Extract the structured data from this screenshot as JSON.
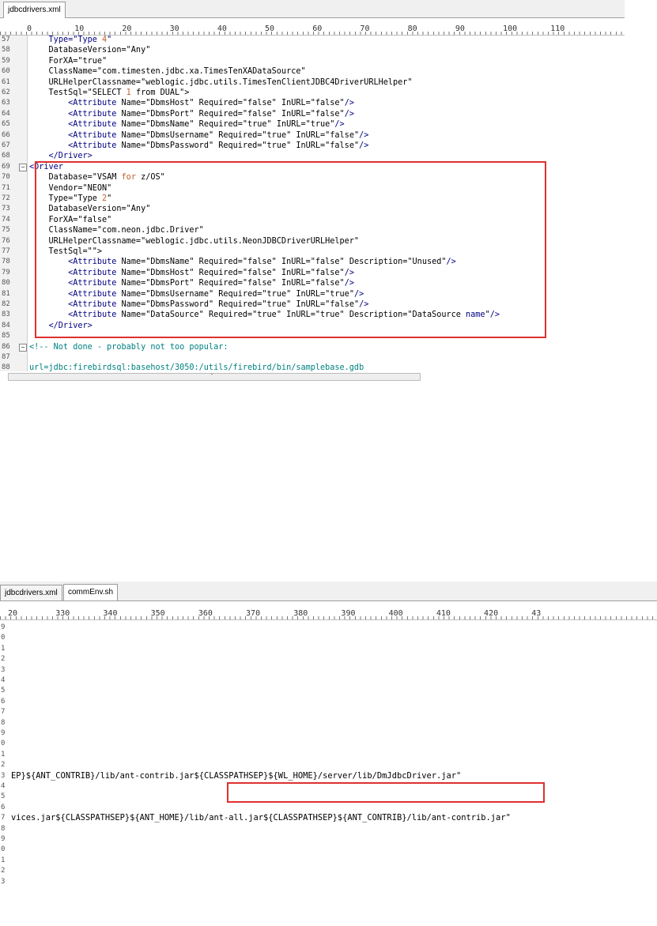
{
  "panel1": {
    "tabs": [
      {
        "label": "jdbcdrivers.xml",
        "active": true
      }
    ],
    "ruler": "0         10        20        30        40        50        60        70        80        90        100       110",
    "lines": [
      {
        "num": "57",
        "segments": [
          {
            "t": "    ",
            "c": "v"
          },
          {
            "t": "Type=",
            "c": "t"
          },
          {
            "t": "\"Type ",
            "c": "s"
          },
          {
            "t": "4",
            "c": "k"
          },
          {
            "t": "\"",
            "c": "s"
          }
        ]
      },
      {
        "num": "58",
        "segments": [
          {
            "t": "    DatabaseVersion=\"Any\"",
            "c": "v"
          }
        ]
      },
      {
        "num": "59",
        "segments": [
          {
            "t": "    ForXA=\"true\"",
            "c": "v"
          }
        ]
      },
      {
        "num": "60",
        "segments": [
          {
            "t": "    ClassName=\"com.timesten.jdbc.xa.TimesTenXADataSource\"",
            "c": "v"
          }
        ]
      },
      {
        "num": "61",
        "segments": [
          {
            "t": "    URLHelperClassname=\"weblogic.jdbc.utils.TimesTenClientJDBC4DriverURLHelper\"",
            "c": "v"
          }
        ]
      },
      {
        "num": "62",
        "segments": [
          {
            "t": "    TestSql=\"SELECT ",
            "c": "v"
          },
          {
            "t": "1",
            "c": "k"
          },
          {
            "t": " from DUAL\">",
            "c": "v"
          }
        ]
      },
      {
        "num": "63",
        "segments": [
          {
            "t": "        <Attribute ",
            "c": "t"
          },
          {
            "t": "Name=\"DbmsHost\" Required=\"false\" InURL=\"false\"",
            "c": "v"
          },
          {
            "t": "/>",
            "c": "t"
          }
        ]
      },
      {
        "num": "64",
        "segments": [
          {
            "t": "        <Attribute ",
            "c": "t"
          },
          {
            "t": "Name=\"DbmsPort\" Required=\"false\" InURL=\"false\"",
            "c": "v"
          },
          {
            "t": "/>",
            "c": "t"
          }
        ]
      },
      {
        "num": "65",
        "segments": [
          {
            "t": "        <Attribute ",
            "c": "t"
          },
          {
            "t": "Name=\"DbmsName\" Required=\"true\" InURL=\"true\"",
            "c": "v"
          },
          {
            "t": "/>",
            "c": "t"
          }
        ]
      },
      {
        "num": "66",
        "segments": [
          {
            "t": "        <Attribute ",
            "c": "t"
          },
          {
            "t": "Name=\"DbmsUsername\" Required=\"true\" InURL=\"false\"",
            "c": "v"
          },
          {
            "t": "/>",
            "c": "t"
          }
        ]
      },
      {
        "num": "67",
        "segments": [
          {
            "t": "        <Attribute ",
            "c": "t"
          },
          {
            "t": "Name=\"DbmsPassword\" Required=\"true\" InURL=\"false\"",
            "c": "v"
          },
          {
            "t": "/>",
            "c": "t"
          }
        ]
      },
      {
        "num": "68",
        "segments": [
          {
            "t": "    </Driver>",
            "c": "t"
          }
        ]
      },
      {
        "num": "69",
        "fold": true,
        "segments": [
          {
            "t": "<Driver",
            "c": "t"
          }
        ]
      },
      {
        "num": "70",
        "segments": [
          {
            "t": "    Database=\"VSAM ",
            "c": "v"
          },
          {
            "t": "for",
            "c": "k"
          },
          {
            "t": " z/OS\"",
            "c": "v"
          }
        ]
      },
      {
        "num": "71",
        "segments": [
          {
            "t": "    Vendor=\"NEON\"",
            "c": "v"
          }
        ]
      },
      {
        "num": "72",
        "segments": [
          {
            "t": "    Type=\"Type ",
            "c": "v"
          },
          {
            "t": "2",
            "c": "k"
          },
          {
            "t": "\"",
            "c": "v"
          }
        ]
      },
      {
        "num": "73",
        "segments": [
          {
            "t": "    DatabaseVersion=\"Any\"",
            "c": "v"
          }
        ]
      },
      {
        "num": "74",
        "segments": [
          {
            "t": "    ForXA=\"false\"",
            "c": "v"
          }
        ]
      },
      {
        "num": "75",
        "segments": [
          {
            "t": "    ClassName=\"com.neon.jdbc.Driver\"",
            "c": "v"
          }
        ]
      },
      {
        "num": "76",
        "segments": [
          {
            "t": "    URLHelperClassname=\"weblogic.jdbc.utils.NeonJDBCDriverURLHelper\"",
            "c": "v"
          }
        ]
      },
      {
        "num": "77",
        "segments": [
          {
            "t": "    TestSql=\"\">",
            "c": "v"
          }
        ]
      },
      {
        "num": "78",
        "segments": [
          {
            "t": "        <Attribute ",
            "c": "t"
          },
          {
            "t": "Name=\"DbmsName\" Required=\"false\" InURL=\"false\" Description=\"Unused\"",
            "c": "v"
          },
          {
            "t": "/>",
            "c": "t"
          }
        ]
      },
      {
        "num": "79",
        "segments": [
          {
            "t": "        <Attribute ",
            "c": "t"
          },
          {
            "t": "Name=\"DbmsHost\" Required=\"false\" InURL=\"false\"",
            "c": "v"
          },
          {
            "t": "/>",
            "c": "t"
          }
        ]
      },
      {
        "num": "80",
        "segments": [
          {
            "t": "        <Attribute ",
            "c": "t"
          },
          {
            "t": "Name=\"DbmsPort\" Required=\"false\" InURL=\"false\"",
            "c": "v"
          },
          {
            "t": "/>",
            "c": "t"
          }
        ]
      },
      {
        "num": "81",
        "segments": [
          {
            "t": "        <Attribute ",
            "c": "t"
          },
          {
            "t": "Name=\"DbmsUsername\" Required=\"true\" InURL=\"true\"",
            "c": "v"
          },
          {
            "t": "/>",
            "c": "t"
          }
        ]
      },
      {
        "num": "82",
        "segments": [
          {
            "t": "        <Attribute ",
            "c": "t"
          },
          {
            "t": "Name=\"DbmsPassword\" Required=\"true\" InURL=\"false\"",
            "c": "v"
          },
          {
            "t": "/>",
            "c": "t"
          }
        ]
      },
      {
        "num": "83",
        "segments": [
          {
            "t": "        <Attribute ",
            "c": "t"
          },
          {
            "t": "Name=\"DataSource\" Required=\"true\" InURL=\"true\" Description=\"DataSource ",
            "c": "v"
          },
          {
            "t": "name",
            "c": "t"
          },
          {
            "t": "\"",
            "c": "v"
          },
          {
            "t": "/>",
            "c": "t"
          }
        ]
      },
      {
        "num": "84",
        "segments": [
          {
            "t": "    </Driver>",
            "c": "t"
          }
        ]
      },
      {
        "num": "85",
        "segments": [
          {
            "t": "",
            "c": "v"
          }
        ]
      },
      {
        "num": "86",
        "fold": true,
        "segments": [
          {
            "t": "<!-- Not done - probably not too popular:",
            "c": "c"
          }
        ]
      },
      {
        "num": "87",
        "segments": [
          {
            "t": "",
            "c": "v"
          }
        ]
      },
      {
        "num": "88",
        "segments": [
          {
            "t": "url=jdbc:firebirdsql:basehost/3050:/utils/firebird/bin/samplebase.gdb",
            "c": "c"
          }
        ]
      }
    ],
    "scroll_grip": "″"
  },
  "panel2": {
    "tabs": [
      {
        "label": "jdbcdrivers.xml",
        "active": false
      },
      {
        "label": "commEnv.sh",
        "active": true
      }
    ],
    "ruler": "20        330       340       350       360       370       380       390       400       410       420       43",
    "gutter_digits": [
      "9",
      "0",
      "1",
      "2",
      "3",
      "4",
      "5",
      "6",
      "7",
      "8",
      "9",
      "0",
      "1",
      "2",
      "3",
      "4",
      "5",
      "6",
      "7",
      "8",
      "9",
      "0",
      "1",
      "2",
      "3"
    ],
    "lines": [
      {
        "row": 14,
        "text": "EP}${ANT_CONTRIB}/lib/ant-contrib.jar${CLASSPATHSEP}${WL_HOME}/server/lib/DmJdbcDriver.jar\""
      },
      {
        "row": 18,
        "text": "vices.jar${CLASSPATHSEP}${ANT_HOME}/lib/ant-all.jar${CLASSPATHSEP}${ANT_CONTRIB}/lib/ant-contrib.jar\""
      }
    ]
  }
}
